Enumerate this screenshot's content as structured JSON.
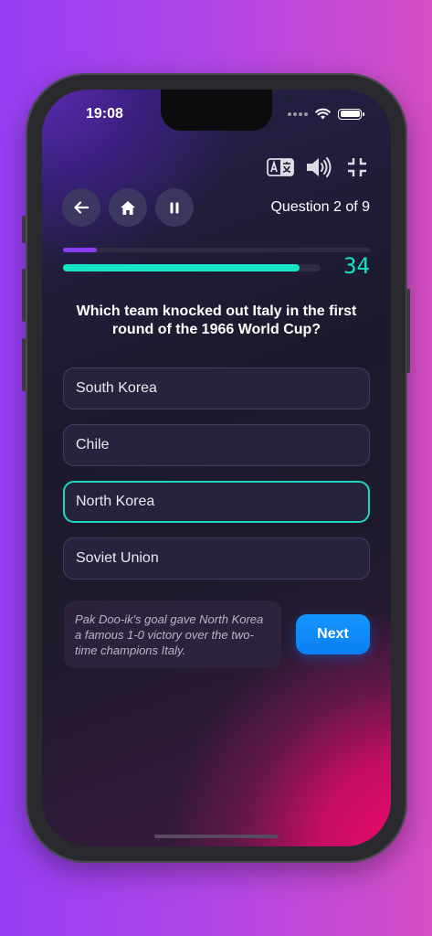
{
  "status_bar": {
    "time": "19:08"
  },
  "toolbar": {
    "icons": [
      "translate-icon",
      "speaker-icon",
      "collapse-icon"
    ]
  },
  "nav": {
    "icons": [
      "back-arrow-icon",
      "home-icon",
      "pause-icon"
    ],
    "question_counter": "Question 2 of 9"
  },
  "progress": {
    "questions_fraction": 0.11,
    "timer_fraction": 0.92,
    "timer_value": "34"
  },
  "question": {
    "text": "Which team knocked out Italy in the first round of the 1966 World Cup?"
  },
  "options": [
    {
      "label": "South Korea",
      "selected": false
    },
    {
      "label": "Chile",
      "selected": false
    },
    {
      "label": "North Korea",
      "selected": true
    },
    {
      "label": "Soviet Union",
      "selected": false
    }
  ],
  "explanation": {
    "text": "Pak Doo-ik's goal gave North Korea a famous 1-0 victory over the two-time champions Italy."
  },
  "actions": {
    "next_label": "Next"
  },
  "colors": {
    "accent_teal": "#14e3c4",
    "accent_purple": "#8a3df0",
    "button_blue": "#0a7ef2",
    "background_left": "#9640f4",
    "background_right": "#d54ec4"
  }
}
